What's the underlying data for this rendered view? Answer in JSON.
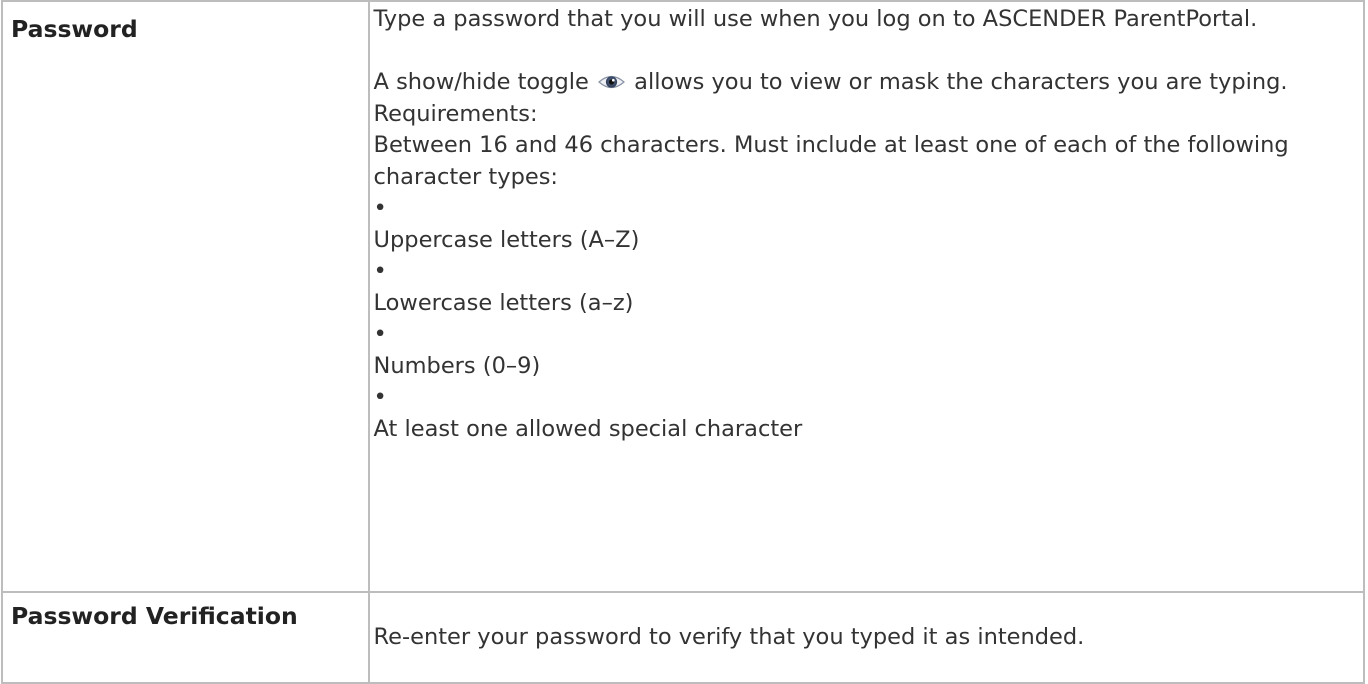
{
  "table": {
    "rows": [
      {
        "label": "Password",
        "intro": "Type a password that you will use when you log on to ASCENDER ParentPortal.",
        "toggle_before": "A show/hide toggle",
        "toggle_icon": "eye-icon",
        "toggle_after": "allows you to view or mask the characters you are typing.",
        "requirements_heading": "Requirements:",
        "requirements_text": "Between 16 and 46 characters. Must include at least one of each of the following character types:",
        "bullet": "•",
        "bullets": [
          "Uppercase letters (A–Z)",
          "Lowercase letters (a–z)",
          "Numbers (0–9)",
          "At least one allowed special character"
        ]
      },
      {
        "label": "Password Verification",
        "description": "Re-enter your password to verify that you typed it as intended."
      }
    ]
  }
}
